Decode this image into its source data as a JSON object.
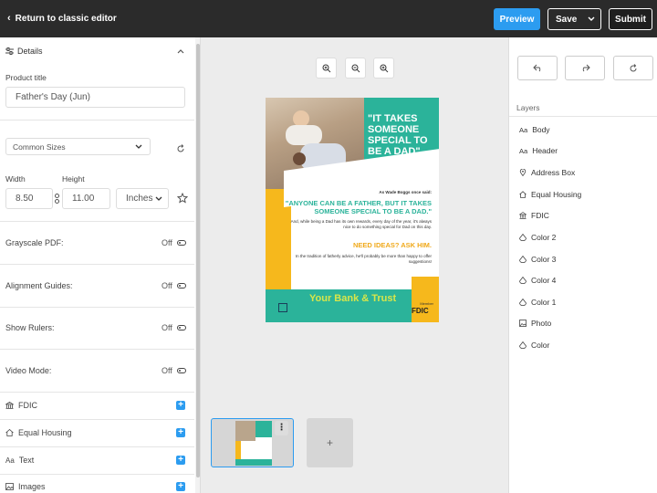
{
  "topbar": {
    "back_label": "Return to classic editor",
    "preview_label": "Preview",
    "save_label": "Save",
    "submit_label": "Submit"
  },
  "details": {
    "section_title": "Details",
    "product_title_label": "Product title",
    "product_title_value": "Father's Day (Jun)",
    "size_preset": "Common Sizes",
    "width_label": "Width",
    "height_label": "Height",
    "width_value": "8.50",
    "height_value": "11.00",
    "unit": "Inches"
  },
  "settings": [
    {
      "label": "Grayscale PDF:",
      "value": "Off"
    },
    {
      "label": "Alignment Guides:",
      "value": "Off"
    },
    {
      "label": "Show Rulers:",
      "value": "Off"
    },
    {
      "label": "Video Mode:",
      "value": "Off"
    }
  ],
  "sections": [
    {
      "label": "FDIC",
      "icon": "bank-icon"
    },
    {
      "label": "Equal Housing",
      "icon": "house-icon"
    },
    {
      "label": "Text",
      "icon": "text-icon"
    },
    {
      "label": "Images",
      "icon": "image-icon"
    }
  ],
  "flyer": {
    "headline": "\"IT TAKES SOMEONE SPECIAL TO BE A DAD\"",
    "attribution": "As Wade Boggs once said:",
    "quote": "\"ANYONE CAN BE A FATHER, BUT IT TAKES SOMEONE SPECIAL TO BE A DAD.\"",
    "body": "And, while being a Dad has its own rewards, every day of the year, it's always nice to do something special for Dad on this day.",
    "cta": "NEED IDEAS? ASK HIM.",
    "body2": "In the tradition of fatherly advice, he'll probably be more than happy to offer suggestions!",
    "bank_name": "Your Bank & Trust",
    "fdic": "FDIC",
    "member": "Member",
    "colors": {
      "teal": "#2bb39a",
      "yellow": "#f6b81c"
    }
  },
  "pages": {
    "add_label": "+"
  },
  "layers": {
    "title": "Layers",
    "items": [
      {
        "label": "Body",
        "icon": "text-icon"
      },
      {
        "label": "Header",
        "icon": "text-icon"
      },
      {
        "label": "Address Box",
        "icon": "location-pin-icon"
      },
      {
        "label": "Equal Housing",
        "icon": "house-icon"
      },
      {
        "label": "FDIC",
        "icon": "bank-icon"
      },
      {
        "label": "Color 2",
        "icon": "color-drop-icon"
      },
      {
        "label": "Color 3",
        "icon": "color-drop-icon"
      },
      {
        "label": "Color 4",
        "icon": "color-drop-icon"
      },
      {
        "label": "Color 1",
        "icon": "color-drop-icon"
      },
      {
        "label": "Photo",
        "icon": "image-icon"
      },
      {
        "label": "Color",
        "icon": "color-drop-icon"
      }
    ]
  },
  "accent": "#2c9cf0"
}
